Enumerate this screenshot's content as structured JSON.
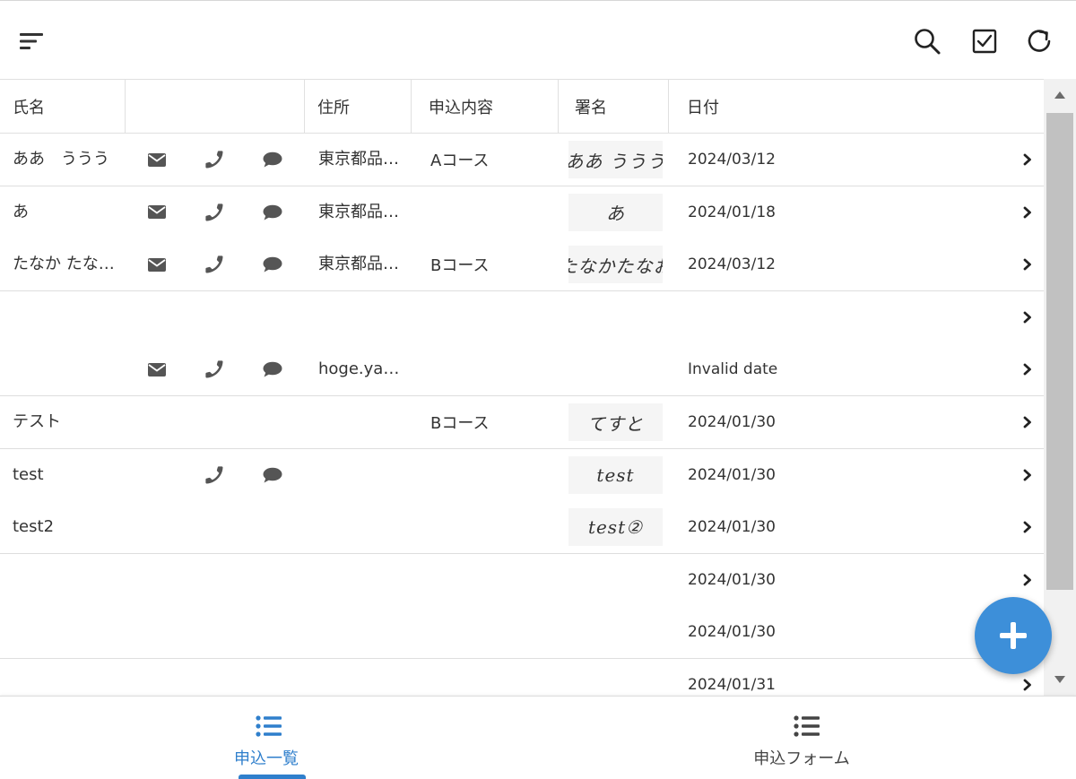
{
  "header": {
    "sort_icon": "sort-lines-icon",
    "search_icon": "search-icon",
    "check_icon": "checkbox-icon",
    "refresh_icon": "refresh-icon"
  },
  "columns": {
    "name": "氏名",
    "contact": "",
    "address": "住所",
    "content": "申込内容",
    "signature": "署名",
    "date": "日付"
  },
  "rows": [
    {
      "name": "ああ　ううう",
      "mail": true,
      "phone": true,
      "chat": true,
      "address": "東京都品川区",
      "content": "Aコース",
      "signature": "ああ ううう",
      "date": "2024/03/12"
    },
    {
      "name": "あ",
      "mail": true,
      "phone": true,
      "chat": true,
      "address": "東京都品川区",
      "content": "",
      "signature": "あ",
      "date": "2024/01/18"
    },
    {
      "name": "たなか たなかたろう",
      "mail": true,
      "phone": true,
      "chat": true,
      "address": "東京都品川区",
      "content": "Bコース",
      "signature": "たなかたなお",
      "date": "2024/03/12"
    },
    {
      "name": "",
      "mail": false,
      "phone": false,
      "chat": false,
      "address": "",
      "content": "",
      "signature": "",
      "date": ""
    },
    {
      "name": "",
      "mail": true,
      "phone": true,
      "chat": true,
      "address": "hoge.yamada",
      "content": "",
      "signature": "",
      "date": "Invalid date"
    },
    {
      "name": "テスト",
      "mail": false,
      "phone": false,
      "chat": false,
      "address": "",
      "content": "Bコース",
      "signature": "てすと",
      "date": "2024/01/30"
    },
    {
      "name": "test",
      "mail": false,
      "phone": true,
      "chat": true,
      "address": "",
      "content": "",
      "signature": "test",
      "date": "2024/01/30"
    },
    {
      "name": "test2",
      "mail": false,
      "phone": false,
      "chat": false,
      "address": "",
      "content": "",
      "signature": "test②",
      "date": "2024/01/30"
    },
    {
      "name": "",
      "mail": false,
      "phone": false,
      "chat": false,
      "address": "",
      "content": "",
      "signature": "",
      "date": "2024/01/30"
    },
    {
      "name": "",
      "mail": false,
      "phone": false,
      "chat": false,
      "address": "",
      "content": "",
      "signature": "",
      "date": "2024/01/30"
    },
    {
      "name": "",
      "mail": false,
      "phone": false,
      "chat": false,
      "address": "",
      "content": "",
      "signature": "",
      "date": "2024/01/31"
    }
  ],
  "fab": {
    "icon": "plus-icon"
  },
  "bottom_nav": {
    "items": [
      {
        "label": "申込一覧",
        "icon": "list-icon",
        "active": true
      },
      {
        "label": "申込フォーム",
        "icon": "list-icon",
        "active": false
      }
    ]
  },
  "colors": {
    "accent": "#2f7fcc",
    "fab": "#3d8fd9",
    "icon": "#555555"
  }
}
